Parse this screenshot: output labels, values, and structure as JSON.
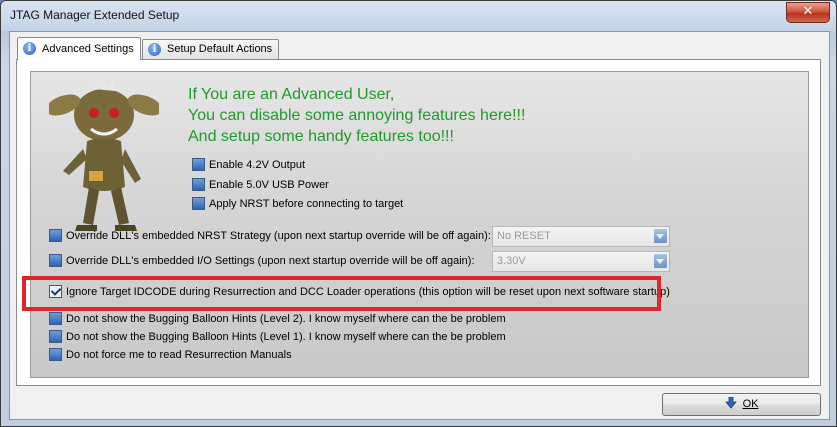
{
  "window": {
    "title": "JTAG Manager Extended Setup",
    "close_label": "✕"
  },
  "tabs": [
    {
      "label": "Advanced Settings",
      "icon": "info-icon",
      "active": true
    },
    {
      "label": "Setup Default Actions",
      "icon": "info-icon",
      "active": false
    }
  ],
  "headline": [
    "If You are an Advanced User,",
    "You can disable some annoying features here!!!",
    "And setup some handy features too!!!"
  ],
  "options": {
    "enable_42v": {
      "label": "Enable 4.2V Output",
      "checked": false
    },
    "enable_50v": {
      "label": "Enable 5.0V USB Power",
      "checked": false
    },
    "apply_nrst": {
      "label": "Apply NRST before connecting to target",
      "checked": false
    },
    "override_nrst": {
      "label": "Override DLL's embedded NRST Strategy (upon next startup override will be off again):",
      "checked": false
    },
    "override_io": {
      "label": "Override DLL's embedded I/O Settings (upon next startup override will be off again):",
      "checked": false
    },
    "ignore_idcode": {
      "label": "Ignore Target IDCODE during Resurrection and DCC Loader operations (this option will be reset upon next software startup)",
      "checked": true
    },
    "no_hints_l2": {
      "label": "Do not show the Bugging Balloon Hints (Level 2). I know myself where can the be problem",
      "checked": false
    },
    "no_hints_l1": {
      "label": "Do not show the Bugging Balloon Hints (Level 1). I know myself where can the be problem",
      "checked": false
    },
    "no_manuals": {
      "label": "Do not force me to read Resurrection Manuals",
      "checked": false
    }
  },
  "combos": {
    "nrst_strategy": {
      "value": "No RESET",
      "enabled": false
    },
    "io_voltage": {
      "value": "3.30V",
      "enabled": false
    }
  },
  "ok_button": {
    "label": "OK",
    "icon": "down-arrow-icon"
  },
  "colors": {
    "headline": "#1f9a2a",
    "highlight": "#e0262a",
    "checkbox": "#2f64b4"
  }
}
